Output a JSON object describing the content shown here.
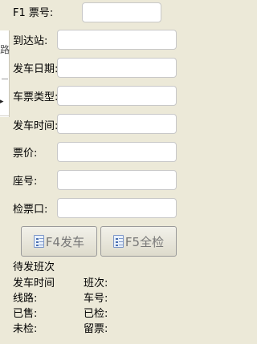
{
  "form": {
    "fields": [
      {
        "key": "ticket_no",
        "label": "F1 票号:",
        "value": ""
      },
      {
        "key": "destination",
        "label": "到达站:",
        "value": ""
      },
      {
        "key": "date",
        "label": "发车日期:",
        "value": ""
      },
      {
        "key": "ticket_type",
        "label": "车票类型:",
        "value": ""
      },
      {
        "key": "time",
        "label": "发车时间:",
        "value": ""
      },
      {
        "key": "price",
        "label": "票价:",
        "value": ""
      },
      {
        "key": "seat",
        "label": "座号:",
        "value": ""
      },
      {
        "key": "gate",
        "label": "检票口:",
        "value": ""
      }
    ]
  },
  "buttons": {
    "depart": {
      "label": "F4发车",
      "icon": "document-list-icon"
    },
    "check_all": {
      "label": "F5全检",
      "icon": "document-list-icon"
    }
  },
  "info": {
    "title": "待发班次",
    "depart_time": "发车时间",
    "shift": "班次:",
    "route": "线路:",
    "bus_no": "车号:",
    "sold": "已售:",
    "checked": "已检:",
    "unchecked": "未检:",
    "reserved": "留票:"
  },
  "side_panel": {
    "partial_text": "路",
    "arrow": "▸"
  },
  "colors": {
    "background": "#ece9d8",
    "input_bg": "#ffffff",
    "button_text": "#777777"
  }
}
